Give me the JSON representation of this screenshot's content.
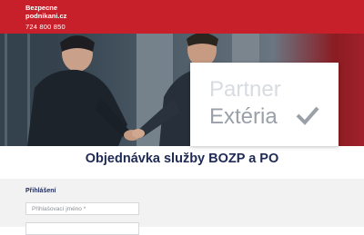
{
  "header": {
    "brand": "Bezpecne podnikani.cz",
    "phone": "724 800 850"
  },
  "hero": {
    "partner_line1": "Partner",
    "partner_line2": "Extéria",
    "check_icon": "checkmark-icon"
  },
  "page": {
    "title": "Objednávka služby BOZP a PO"
  },
  "form": {
    "section_label": "Přihlášení",
    "username_placeholder": "Přihlašovací jméno *",
    "password_placeholder": ""
  },
  "colors": {
    "brand_red": "#c8202a",
    "title_navy": "#1f2a55"
  }
}
